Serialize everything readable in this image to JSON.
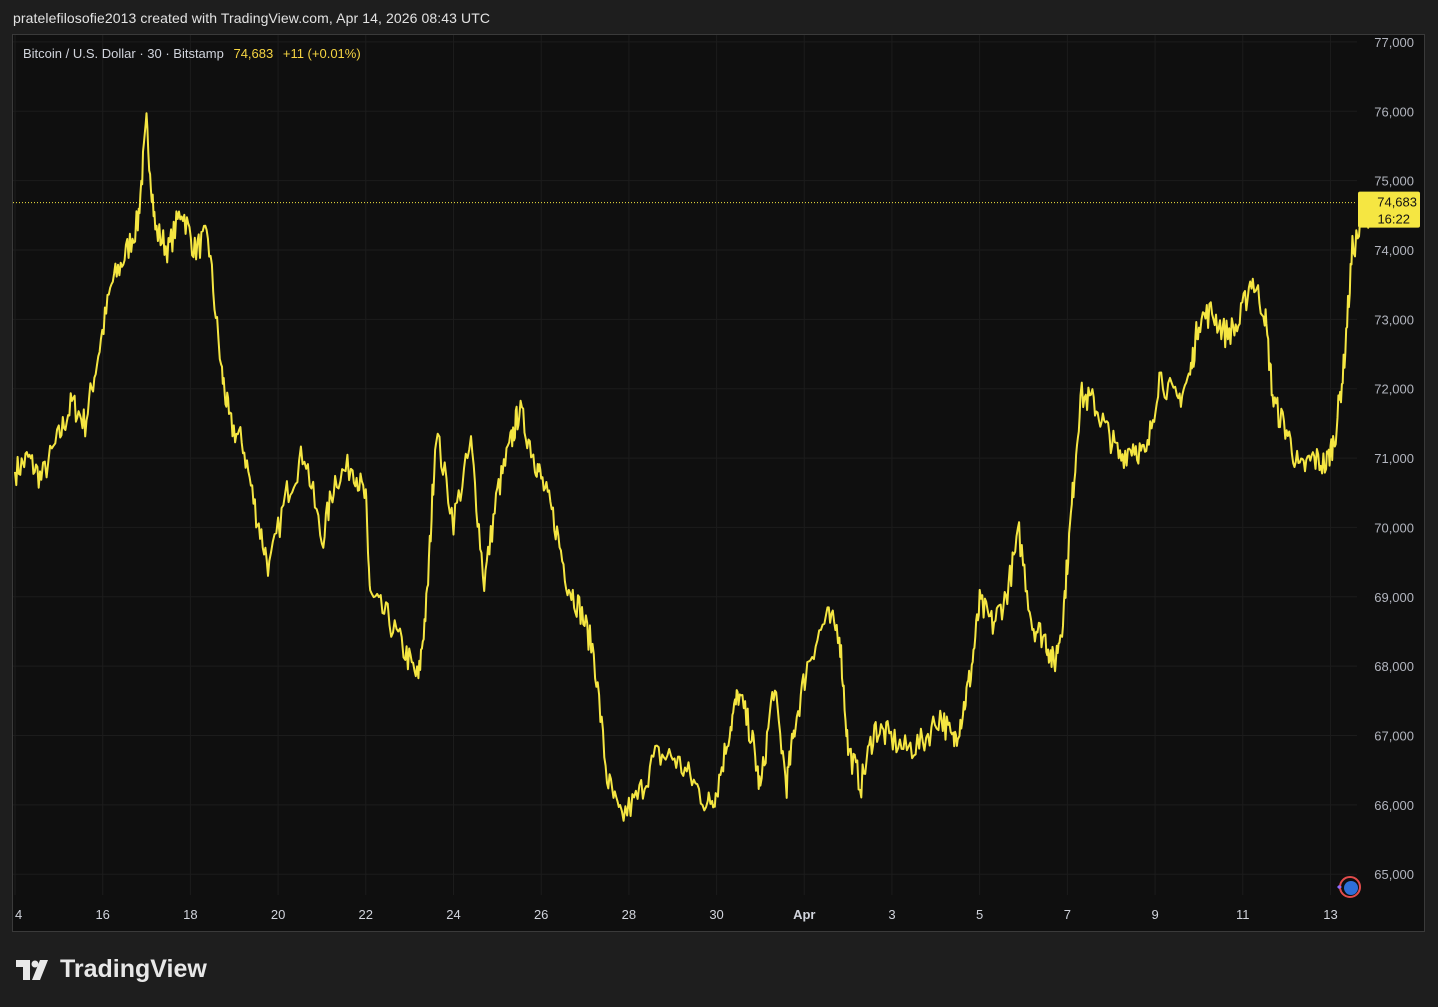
{
  "header": {
    "text": "pratelefilosofie2013 created with TradingView.com, Apr 14, 2026 08:43 UTC"
  },
  "legend": {
    "symbol": "Bitcoin / U.S. Dollar · 30 · Bitstamp",
    "price": "74,683",
    "change": "+11 (+0.01%)"
  },
  "price_badge": {
    "price": "74,683",
    "countdown": "16:22"
  },
  "logo": {
    "text": "TradingView"
  },
  "colors": {
    "line": "#f5e642",
    "badge": "#f5e642",
    "background": "#0f0f0f",
    "grid": "#1c1c1c"
  },
  "chart_data": {
    "type": "line",
    "series": [
      {
        "name": "Bitcoin / U.S. Dollar",
        "points": [
          [
            14.0,
            70800
          ],
          [
            14.3,
            71000
          ],
          [
            14.6,
            70700
          ],
          [
            15.0,
            71300
          ],
          [
            15.3,
            71800
          ],
          [
            15.6,
            71500
          ],
          [
            15.9,
            72500
          ],
          [
            16.2,
            73500
          ],
          [
            16.5,
            73900
          ],
          [
            16.8,
            74400
          ],
          [
            17.0,
            75800
          ],
          [
            17.2,
            74300
          ],
          [
            17.5,
            74000
          ],
          [
            17.8,
            74600
          ],
          [
            18.1,
            74000
          ],
          [
            18.4,
            74200
          ],
          [
            18.7,
            72300
          ],
          [
            18.9,
            71500
          ],
          [
            19.2,
            71200
          ],
          [
            19.5,
            70200
          ],
          [
            19.8,
            69400
          ],
          [
            20.2,
            70500
          ],
          [
            20.6,
            71100
          ],
          [
            21.0,
            69800
          ],
          [
            21.3,
            70700
          ],
          [
            21.7,
            70900
          ],
          [
            22.0,
            70400
          ],
          [
            22.1,
            69000
          ],
          [
            22.5,
            68700
          ],
          [
            22.9,
            68200
          ],
          [
            23.2,
            67800
          ],
          [
            23.4,
            69000
          ],
          [
            23.6,
            71400
          ],
          [
            24.0,
            70100
          ],
          [
            24.4,
            71200
          ],
          [
            24.7,
            69200
          ],
          [
            25.0,
            70500
          ],
          [
            25.3,
            71200
          ],
          [
            25.5,
            71700
          ],
          [
            25.8,
            71100
          ],
          [
            26.0,
            70700
          ],
          [
            26.3,
            70100
          ],
          [
            26.6,
            69200
          ],
          [
            26.9,
            68800
          ],
          [
            27.2,
            68200
          ],
          [
            27.5,
            66400
          ],
          [
            27.8,
            65800
          ],
          [
            28.2,
            66100
          ],
          [
            28.6,
            66700
          ],
          [
            29.0,
            66700
          ],
          [
            29.4,
            66400
          ],
          [
            29.8,
            66000
          ],
          [
            30.0,
            66200
          ],
          [
            30.3,
            67100
          ],
          [
            30.5,
            67600
          ],
          [
            30.8,
            67000
          ],
          [
            31.0,
            66200
          ],
          [
            31.3,
            67700
          ],
          [
            31.6,
            66300
          ],
          [
            31.8,
            67200
          ],
          [
            32.1,
            68100
          ],
          [
            32.5,
            68700
          ],
          [
            32.8,
            68500
          ],
          [
            33.0,
            66800
          ],
          [
            33.3,
            66300
          ],
          [
            33.6,
            67100
          ],
          [
            33.9,
            67000
          ],
          [
            34.3,
            66800
          ],
          [
            34.7,
            66900
          ],
          [
            35.1,
            67300
          ],
          [
            35.4,
            66900
          ],
          [
            35.6,
            67300
          ],
          [
            35.8,
            67900
          ],
          [
            36.0,
            68900
          ],
          [
            36.3,
            68600
          ],
          [
            36.6,
            69000
          ],
          [
            36.9,
            69900
          ],
          [
            37.2,
            68600
          ],
          [
            37.5,
            68400
          ],
          [
            37.7,
            68000
          ],
          [
            37.9,
            68700
          ],
          [
            38.1,
            70300
          ],
          [
            38.3,
            71900
          ],
          [
            38.6,
            71800
          ],
          [
            38.9,
            71400
          ],
          [
            39.2,
            71000
          ],
          [
            39.5,
            71200
          ],
          [
            39.8,
            71000
          ],
          [
            40.1,
            72200
          ],
          [
            40.5,
            71800
          ],
          [
            40.8,
            72200
          ],
          [
            41.0,
            73000
          ],
          [
            41.3,
            73100
          ],
          [
            41.6,
            72800
          ],
          [
            41.9,
            72900
          ],
          [
            42.2,
            73600
          ],
          [
            42.5,
            73100
          ],
          [
            42.7,
            71800
          ],
          [
            43.0,
            71400
          ],
          [
            43.3,
            70800
          ],
          [
            43.6,
            71000
          ],
          [
            43.9,
            70900
          ],
          [
            44.1,
            71300
          ],
          [
            44.3,
            72300
          ],
          [
            44.5,
            74000
          ],
          [
            44.8,
            74500
          ],
          [
            45.0,
            74600
          ],
          [
            45.1,
            74683
          ]
        ]
      }
    ],
    "ylim": [
      64700,
      77100
    ],
    "xlim": [
      14,
      45.7
    ],
    "yticks": [
      "77,000",
      "76,000",
      "75,000",
      "74,000",
      "73,000",
      "72,000",
      "71,000",
      "70,000",
      "69,000",
      "68,000",
      "67,000",
      "66,000",
      "65,000"
    ],
    "xticks": [
      {
        "label": "4",
        "day": 14,
        "bold": false
      },
      {
        "label": "16",
        "day": 16,
        "bold": false
      },
      {
        "label": "18",
        "day": 18,
        "bold": false
      },
      {
        "label": "20",
        "day": 20,
        "bold": false
      },
      {
        "label": "22",
        "day": 22,
        "bold": false
      },
      {
        "label": "24",
        "day": 24,
        "bold": false
      },
      {
        "label": "26",
        "day": 26,
        "bold": false
      },
      {
        "label": "28",
        "day": 28,
        "bold": false
      },
      {
        "label": "30",
        "day": 30,
        "bold": false
      },
      {
        "label": "Apr",
        "day": 32,
        "bold": true
      },
      {
        "label": "3",
        "day": 34,
        "bold": false
      },
      {
        "label": "5",
        "day": 36,
        "bold": false
      },
      {
        "label": "7",
        "day": 38,
        "bold": false
      },
      {
        "label": "9",
        "day": 40,
        "bold": false
      },
      {
        "label": "11",
        "day": 42,
        "bold": false
      },
      {
        "label": "13",
        "day": 44,
        "bold": false
      }
    ],
    "grid": true,
    "last_price": 74683
  }
}
